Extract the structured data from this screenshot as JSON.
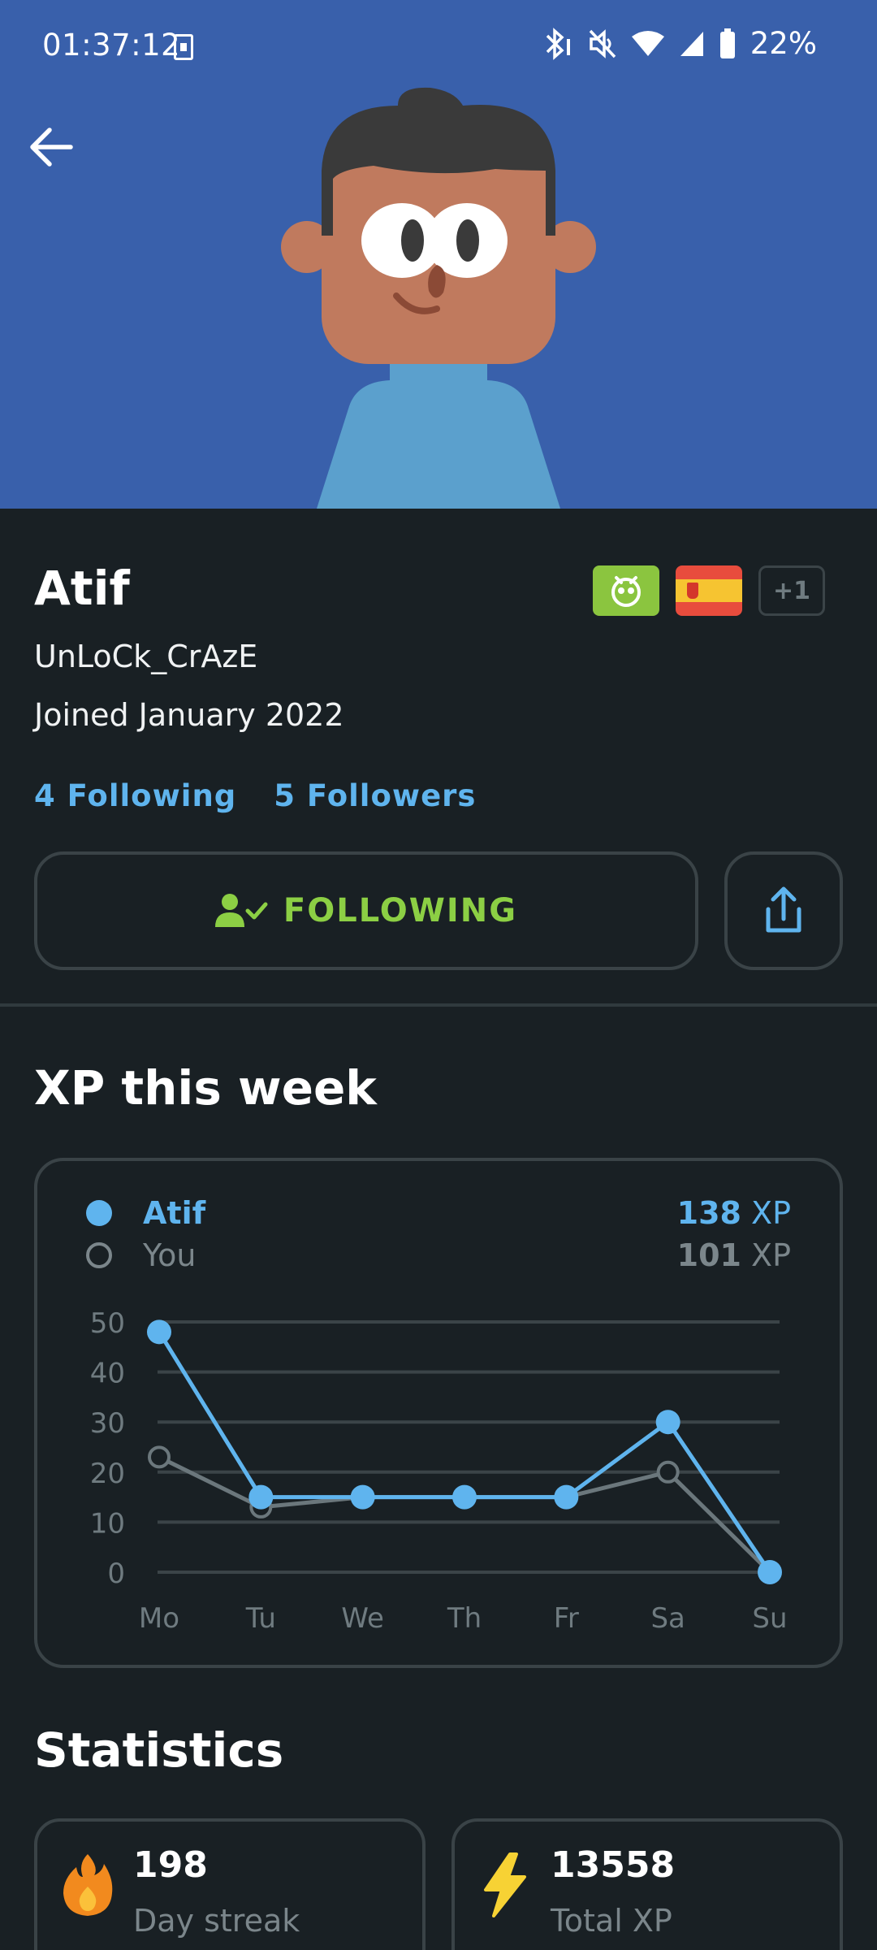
{
  "status_bar": {
    "time": "01:37:12",
    "battery": "22%"
  },
  "header": {
    "background_color": "#3960ab",
    "back_icon": "arrow-left-icon"
  },
  "profile": {
    "name": "Atif",
    "username": "UnLoCk_CrAzE",
    "joined": "Joined January 2022",
    "following_count": "4 Following",
    "followers_count": "5 Followers",
    "badges": [
      "owl-badge",
      "spain-flag-badge"
    ],
    "more_badges": "+1"
  },
  "actions": {
    "following_label": "FOLLOWING",
    "following_icon": "person-check-icon",
    "share_icon": "share-icon"
  },
  "xp_section": {
    "title": "XP this week",
    "legend": [
      {
        "name": "Atif",
        "xp_number": "138",
        "xp_unit": "XP",
        "color": "#5fb4ee"
      },
      {
        "name": "You",
        "xp_number": "101",
        "xp_unit": "XP",
        "color": "#7b868b"
      }
    ]
  },
  "chart_data": {
    "type": "line",
    "categories": [
      "Mo",
      "Tu",
      "We",
      "Th",
      "Fr",
      "Sa",
      "Su"
    ],
    "y_ticks": [
      "50",
      "40",
      "30",
      "20",
      "10",
      "0"
    ],
    "ylim": [
      0,
      50
    ],
    "grid": true,
    "series": [
      {
        "name": "Atif",
        "values": [
          48,
          15,
          15,
          15,
          15,
          30,
          0
        ],
        "color": "#5fb4ee"
      },
      {
        "name": "You",
        "values": [
          23,
          13,
          15,
          15,
          15,
          20,
          0
        ],
        "color": "#6b777c"
      }
    ]
  },
  "statistics": {
    "title": "Statistics",
    "cards": [
      {
        "value": "198",
        "label": "Day streak",
        "icon": "fire-icon"
      },
      {
        "value": "13558",
        "label": "Total XP",
        "icon": "lightning-icon"
      }
    ]
  }
}
